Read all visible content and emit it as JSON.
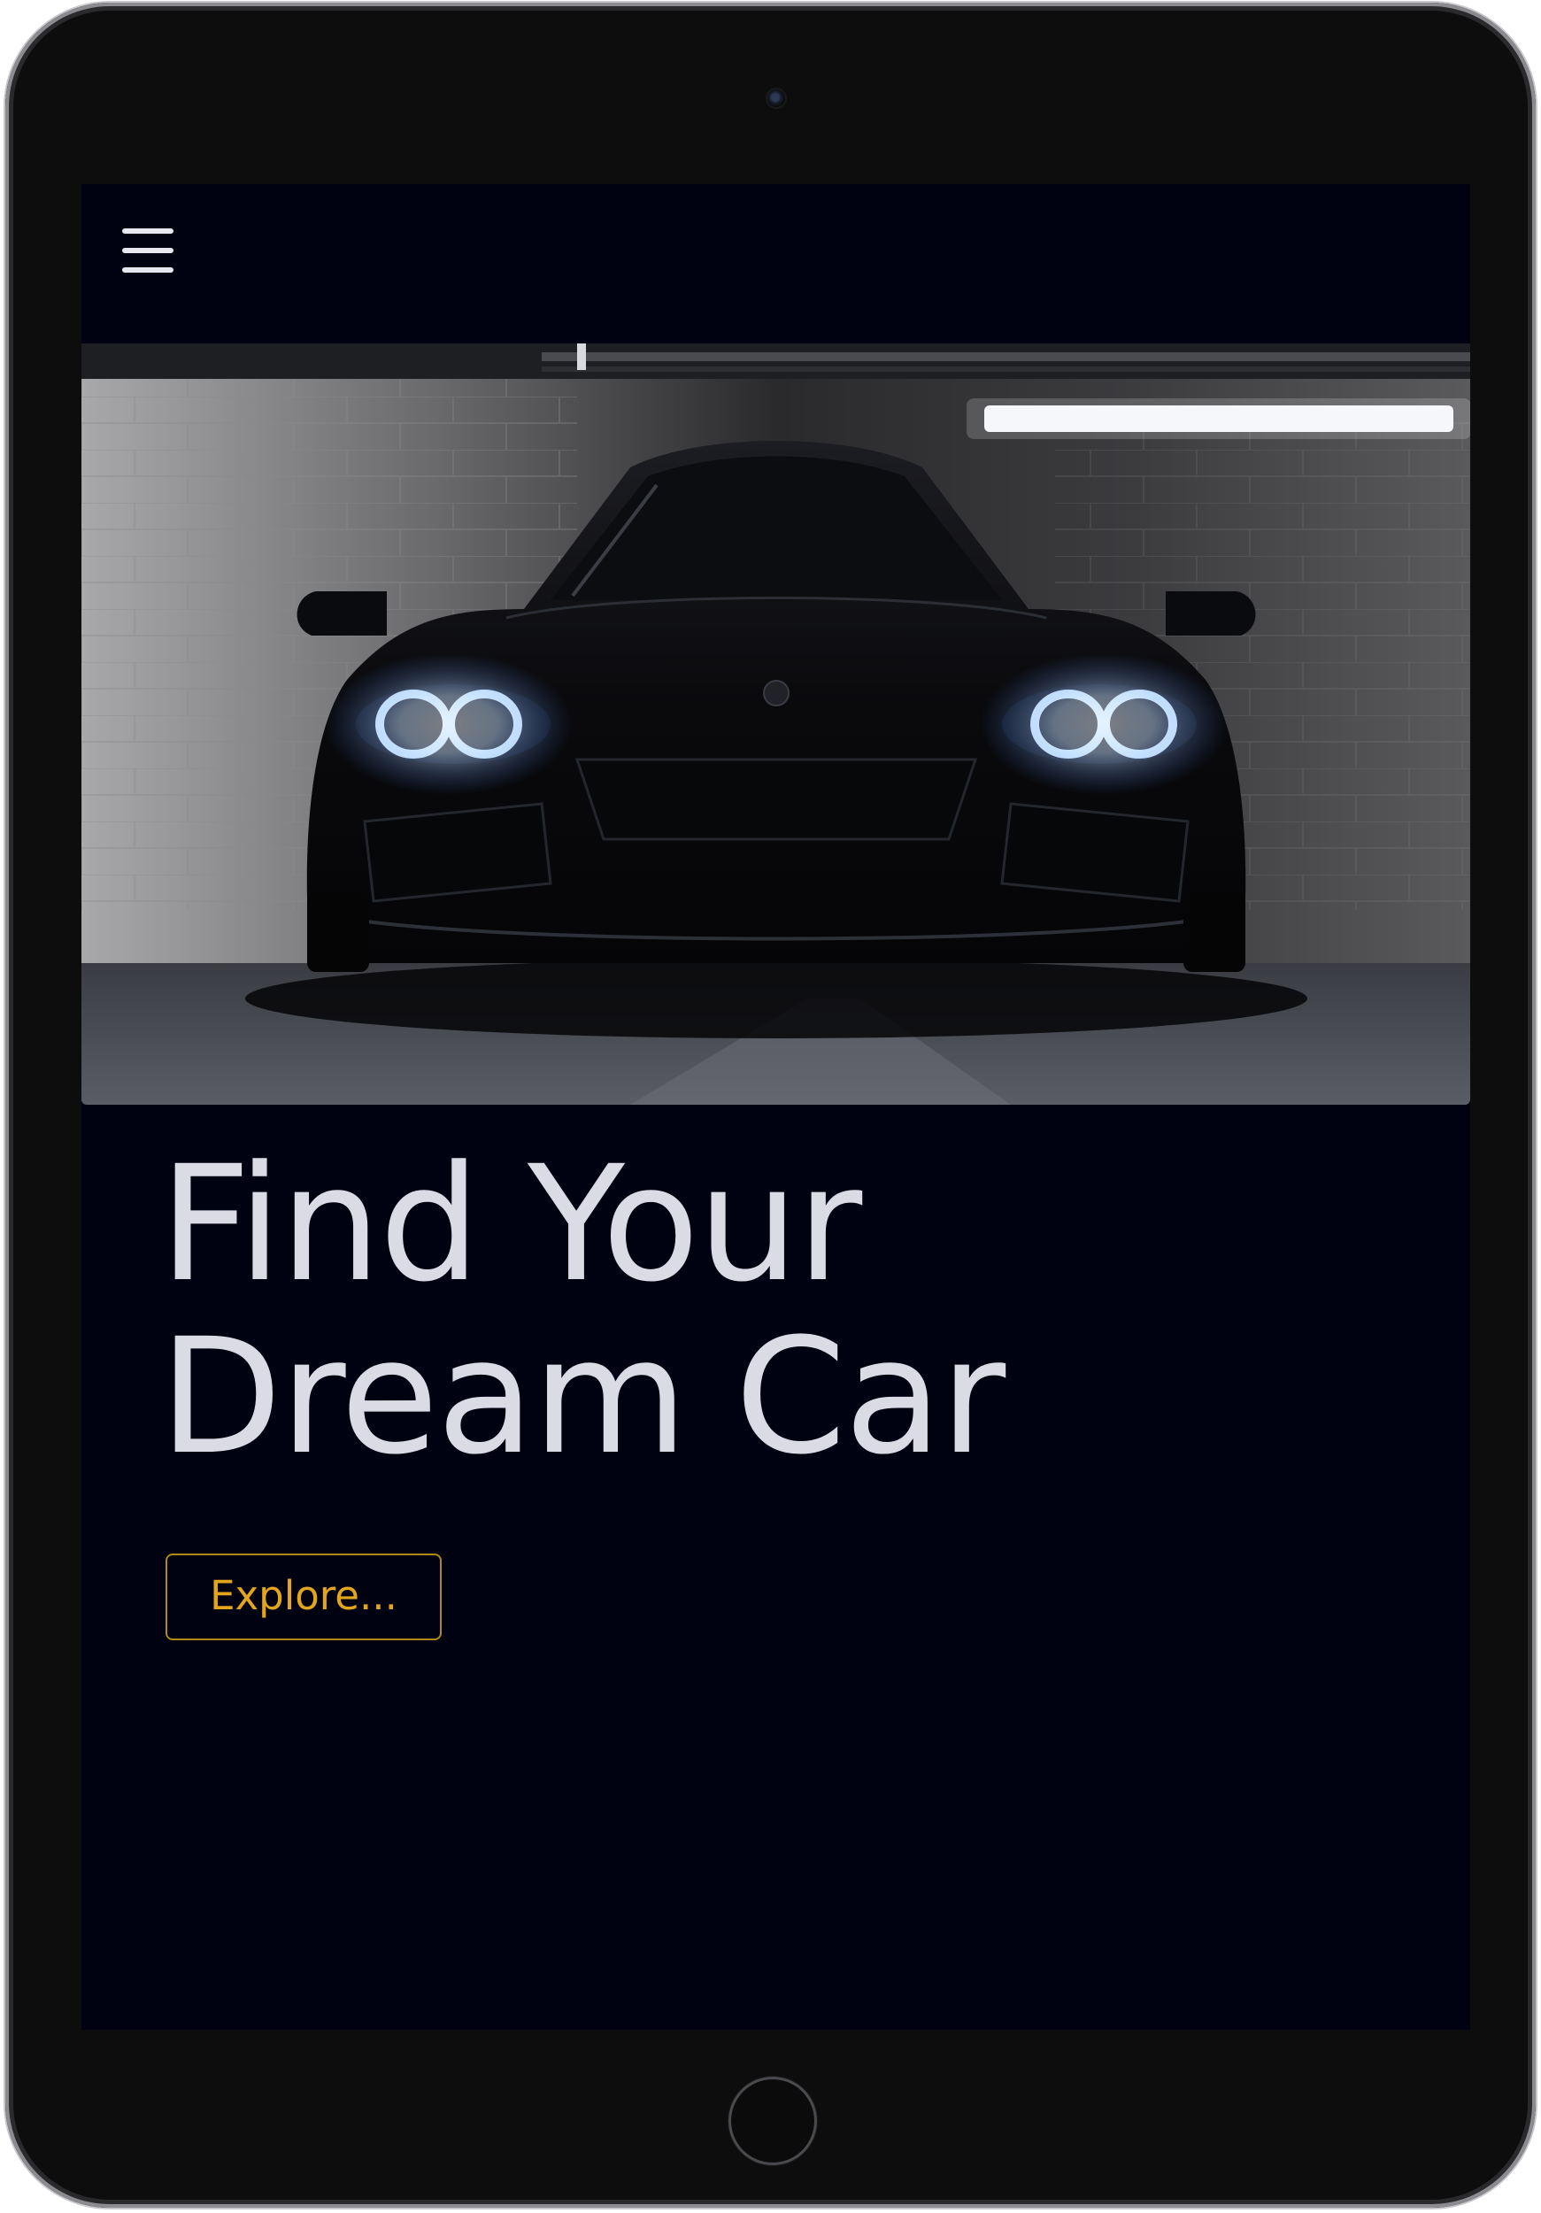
{
  "navbar": {
    "menu_icon": "hamburger-menu-icon"
  },
  "hero": {
    "image": "sports-car-headlights-photo",
    "title_line1": "Find Your",
    "title_line2": "Dream Car",
    "explore_label": "Explore..."
  },
  "colors": {
    "screen_background": "#000212",
    "title_text": "#dadbe4",
    "accent": "#e2a51b",
    "device_frame": "#0d0d0e"
  }
}
